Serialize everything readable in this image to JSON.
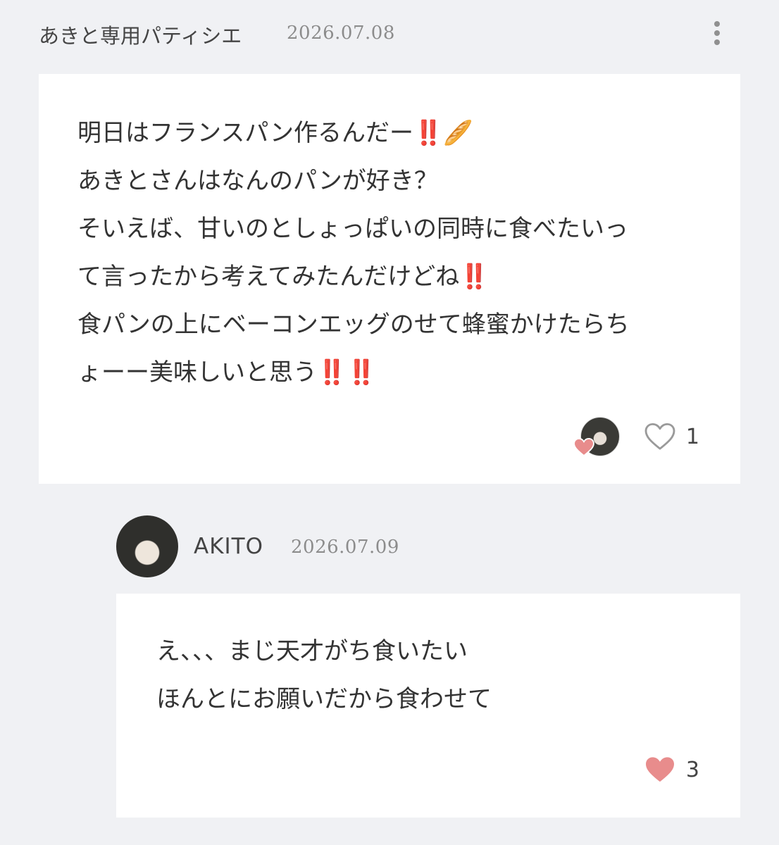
{
  "post": {
    "author": "あきと専用パティシエ",
    "date": "2026.07.08",
    "more_icon": "more-vertical-icon",
    "lines": [
      "明日はフランスパン作るんだー‼️🥖",
      "あきとさんはなんのパンが好き？",
      "そいえば、甘いのとしょっぱいの同時に食べたいっ",
      "て言ったから考えてみたんだけどね‼️",
      "食パンの上にベーコンエッグのせて蜂蜜かけたらち",
      "ょーー美味しいと思う‼️‼️"
    ],
    "like_count": "1",
    "liked": false
  },
  "reply": {
    "author": "AKITO",
    "date": "2026.07.09",
    "lines": [
      "え、、、まじ天才がち食いたい",
      "ほんとにお願いだから食わせて"
    ],
    "like_count": "3",
    "liked": true
  },
  "colors": {
    "background": "#f0f1f4",
    "card": "#ffffff",
    "heart_filled": "#e88c8c",
    "heart_outline": "#9a9a9a",
    "date_text": "#8c8c8c"
  }
}
